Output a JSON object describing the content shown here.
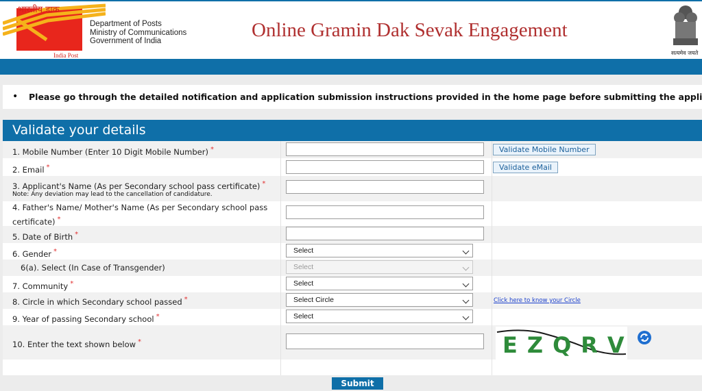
{
  "header": {
    "logo_hindi": "भारतीय डाक",
    "logo_caption": "India Post",
    "dept_line1": "Department of Posts",
    "dept_line2": "Ministry of Communications",
    "dept_line3": "Government of India",
    "title": "Online Gramin Dak Sevak Engagement",
    "emblem_caption": "सत्यमेव जयते"
  },
  "notice": {
    "text": "Please go through the detailed notification and application submission instructions provided in the home page before submitting the application."
  },
  "form": {
    "heading": "Validate your details",
    "mobile_label": "1. Mobile Number (Enter 10 Digit Mobile Number)",
    "mobile_value": "",
    "validate_mobile": "Validate Mobile Number",
    "email_label": "2. Email",
    "email_value": "",
    "validate_email": "Validate eMail",
    "name_label": "3. Applicant's Name (As per Secondary school pass certificate)",
    "name_note": "Note: Any deviation may lead to the cancellation of candidature.",
    "name_value": "",
    "parent_label": "4. Father's Name/ Mother's Name (As per Secondary school pass certificate)",
    "parent_value": "",
    "dob_label": "5. Date of Birth",
    "dob_value": "",
    "gender_label": "6. Gender",
    "gender_selected": "Select",
    "transgender_label": "6(a). Select (In Case of Transgender)",
    "transgender_selected": "Select",
    "community_label": "7. Community",
    "community_selected": "Select",
    "circle_label": "8. Circle in which Secondary school passed",
    "circle_selected": "Select Circle",
    "circle_link": "Click here to know your Circle",
    "year_label": "9. Year of passing Secondary school",
    "year_selected": "Select",
    "captcha_label": "10. Enter the text shown below",
    "captcha_value": "",
    "captcha_text": "EZQRV",
    "required_mark": "*",
    "submit": "Submit"
  },
  "colors": {
    "brand_blue": "#0f6fa8",
    "title_red": "#b03030",
    "required_red": "#e23030",
    "link_blue": "#1a3fcc"
  },
  "icons": {
    "refresh": "refresh-icon",
    "logo": "india-post-logo",
    "emblem": "national-emblem"
  }
}
